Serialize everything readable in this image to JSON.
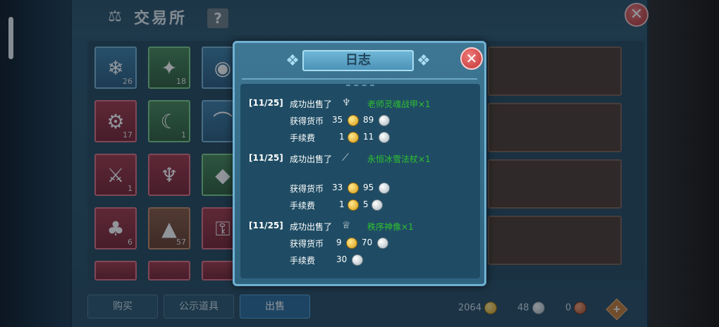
{
  "exchange": {
    "title": "交易所",
    "help_label": "?",
    "close_label": "✕",
    "slots": [
      {
        "count": "26"
      },
      {
        "count": "18"
      },
      {
        "count": "17"
      },
      {
        "count": "1"
      },
      {
        "count": "1"
      },
      {
        "count": "6"
      },
      {
        "count": "57"
      }
    ]
  },
  "bottom": {
    "tabs": [
      {
        "label": "购买"
      },
      {
        "label": "公示道具"
      },
      {
        "label": "出售"
      }
    ],
    "currency": {
      "gold": "2064",
      "silver": "48",
      "copper": "0"
    },
    "add_label": "+"
  },
  "log": {
    "title": "日志",
    "close_label": "✕",
    "entries": [
      {
        "date": "[11/25]",
        "sold_label": "成功出售了",
        "item": "老师灵魂战甲×1",
        "earned_label": "获得货币",
        "earned_gold": "35",
        "earned_silver": "89",
        "fee_label": "手续费",
        "fee_gold": "1",
        "fee_silver": "11"
      },
      {
        "date": "[11/25]",
        "sold_label": "成功出售了",
        "item": "永恒冰雪法杖×1",
        "earned_label": "获得货币",
        "earned_gold": "33",
        "earned_silver": "95",
        "fee_label": "手续费",
        "fee_gold": "1",
        "fee_silver": "5"
      },
      {
        "date": "[11/25]",
        "sold_label": "成功出售了",
        "item": "秩序神像×1",
        "earned_label": "获得货币",
        "earned_gold": "9",
        "earned_silver": "70",
        "fee_label": "手续费",
        "fee_silver": "30"
      }
    ]
  }
}
